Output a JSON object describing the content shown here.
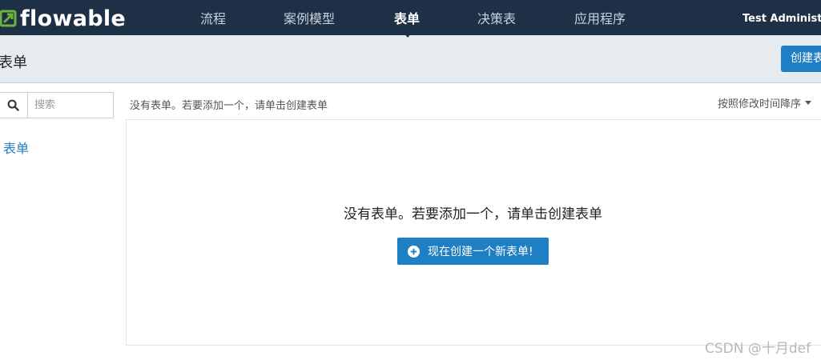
{
  "app": {
    "logo_text": "flowable"
  },
  "nav": {
    "items": [
      {
        "label": "流程"
      },
      {
        "label": "案例模型"
      },
      {
        "label": "表单"
      },
      {
        "label": "决策表"
      },
      {
        "label": "应用程序"
      }
    ],
    "active": "表单",
    "user": "Test Administrator"
  },
  "header": {
    "title": "表单",
    "create_button": "创建表单"
  },
  "sidebar": {
    "search_placeholder": "搜索",
    "filter_label": "表单"
  },
  "content": {
    "empty_hint": "没有表单。若要添加一个，请单击创建表单",
    "sort_label": "按照修改时间降序",
    "empty_message": "没有表单。若要添加一个，请单击创建表单",
    "new_form_button": "现在创建一个新表单!"
  },
  "watermark": "CSDN @十月def",
  "colors": {
    "nav_bg": "#1e3046",
    "accent": "#1f7fc4",
    "logo_green": "#6cb33e",
    "subheader_bg": "#e6ebf0"
  }
}
